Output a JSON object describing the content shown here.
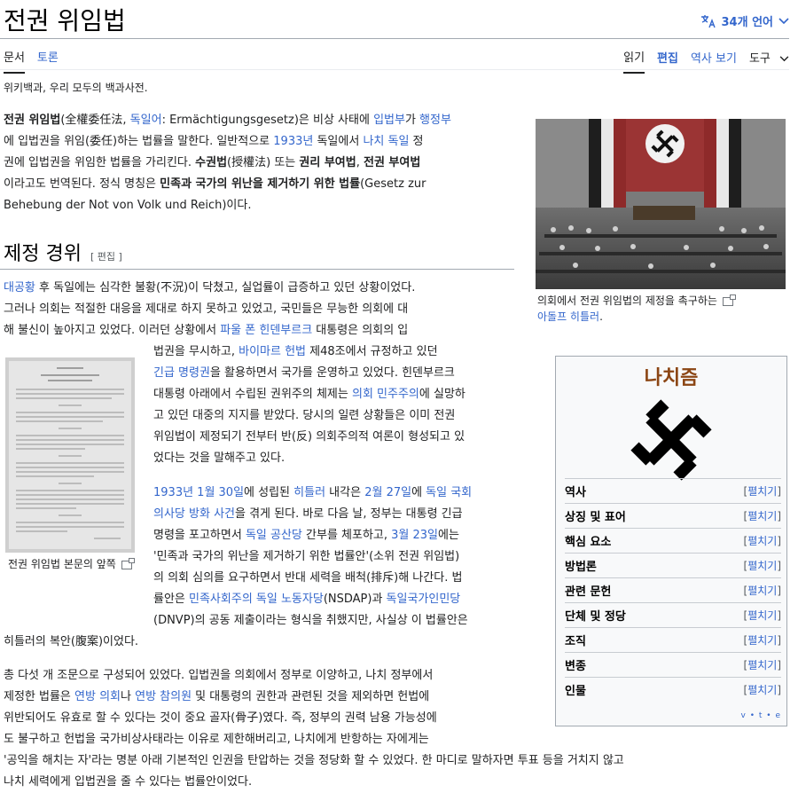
{
  "page": {
    "title": "전권 위임법",
    "languages": "34개 언어",
    "tabs_left": [
      "문서",
      "토론"
    ],
    "tabs_right": [
      "읽기",
      "편집",
      "역사 보기",
      "도구"
    ],
    "tagline": "위키백과, 우리 모두의 백과사전."
  },
  "intro": {
    "l1_a": "전권 위임법",
    "l1_b": "(全權委任法, ",
    "l1_c": "독일어",
    "l1_d": ": Ermächtigungsgesetz)은 비상 사태에 ",
    "l1_e": "입법부",
    "l1_f": "가 ",
    "l1_g": "행정부",
    "l2_a": "에 입법권을 위임(委任)하는 법률을 말한다. 일반적으로 ",
    "l2_b": "1933년",
    "l2_c": " 독일에서 ",
    "l2_d": "나치 독일",
    "l2_e": " 정",
    "l3_a": "권에 입법권을 위임한 법률을 가리킨다. ",
    "l3_b": "수권법",
    "l3_c": "(授權法) 또는 ",
    "l3_d": "권리 부여법",
    "l3_e": ", ",
    "l3_f": "전권 부여법",
    "l4_a": "이라고도 번역된다. 정식 명칭은 ",
    "l4_b": "민족과 국가의 위난을 제거하기 위한 법률",
    "l4_c": "(Gesetz zur",
    "l5": "Behebung der Not von Volk und Reich)이다."
  },
  "section": {
    "heading": "제정 경위",
    "edit": "[ 편집 ]"
  },
  "photo": {
    "caption_a": "의회에서 전권 위임법의 제정을 촉구하는",
    "caption_b": "아돌프 히틀러",
    "caption_c": "."
  },
  "doc": {
    "caption": "전권 위임법 본문의 앞쪽"
  },
  "para1": {
    "l1_a": "대공황",
    "l1_b": " 후 독일에는 심각한 불황(不況)이 닥쳤고, 실업률이 급증하고 있던 상황이었다.",
    "l2": "그러나 의회는 적절한 대응을 제대로 하지 못하고 있었고, 국민들은 무능한 의회에 대",
    "l3_a": "해 불신이 높아지고 있었다. 이러던 상황에서 ",
    "l3_b": "파울 폰 힌덴부르크",
    "l3_c": " 대통령은 의회의 입",
    "l4_a": "법권을 무시하고, ",
    "l4_b": "바이마르 헌법",
    "l4_c": " 제48조에서 규정하고 있던",
    "l5_a": "긴급 명령권",
    "l5_b": "을 활용하면서 국가를 운영하고 있었다. 힌덴부르크",
    "l6_a": "대통령 아래에서 수립된 권위주의 체제는 ",
    "l6_b": "의회 민주주의",
    "l6_c": "에 실망하",
    "l7": "고 있던 대중의 지지를 받았다. 당시의 일련 상황들은 이미 전권",
    "l8": "위임법이 제정되기 전부터 반(反) 의회주의적 여론이 형성되고 있",
    "l9": "었다는 것을 말해주고 있다."
  },
  "para2": {
    "l1_a": "1933년 1월 30일",
    "l1_b": "에 성립된 ",
    "l1_c": "히틀러",
    "l1_d": " 내각은 ",
    "l1_e": "2월 27일",
    "l1_f": "에 ",
    "l1_g": "독일 국회",
    "l2_a": "의사당 방화 사건",
    "l2_b": "을 겪게 된다. 바로 다음 날, 정부는 대통령 긴급",
    "l3_a": "명령을 포고하면서 ",
    "l3_b": "독일 공산당",
    "l3_c": " 간부를 체포하고, ",
    "l3_d": "3월 23일",
    "l3_e": "에는",
    "l4": "'민족과 국가의 위난을 제거하기 위한 법률안'(소위 전권 위임법)",
    "l5": "의 의회 심의를 요구하면서 반대 세력을 배척(排斥)해 나간다. 법",
    "l6_a": "률안은 ",
    "l6_b": "민족사회주의 독일 노동자당",
    "l6_c": "(NSDAP)과 ",
    "l6_d": "독일국가인민당",
    "l7": "(DNVP)의 공동 제출이라는 형식을 취했지만, 사실상 이 법률안은",
    "l8": "히틀러의 복안(腹案)이었다."
  },
  "para3": {
    "l1": "총 다섯 개 조문으로 구성되어 있었다. 입법권을 의회에서 정부로 이양하고, 나치 정부에서",
    "l2_a": "제정한 법률은 ",
    "l2_b": "연방 의회",
    "l2_c": "나 ",
    "l2_d": "연방 참의원",
    "l2_e": " 및 대통령의 권한과 관련된 것을 제외하면 헌법에",
    "l3": "위반되어도 유효로 할 수 있다는 것이 중요 골자(骨子)였다. 즉, 정부의 권력 남용 가능성에",
    "l4": "도 불구하고 헌법을 국가비상사태라는 이유로 제한해버리고, 나치에게 반항하는 자에게는",
    "l5": "'공익을 해치는 자'라는 명분 아래 기본적인 인권을 탄압하는 것을 정당화 할 수 있었다. 한 마디로 말하자면 투표 등을 거치지 않고",
    "l6": "나치 세력에게 입법권을 줄 수 있다는 법률안이었다."
  },
  "infobox": {
    "title": "나치즘",
    "toggle": "펼치기",
    "rows": [
      "역사",
      "상징 및 표어",
      "핵심 요소",
      "방법론",
      "관련 문헌",
      "단체 및 정당",
      "조직",
      "변종",
      "인물"
    ],
    "vte": "v • t • e"
  },
  "colors": {
    "link": "#3366cc",
    "infobox_title": "#8b4513"
  }
}
